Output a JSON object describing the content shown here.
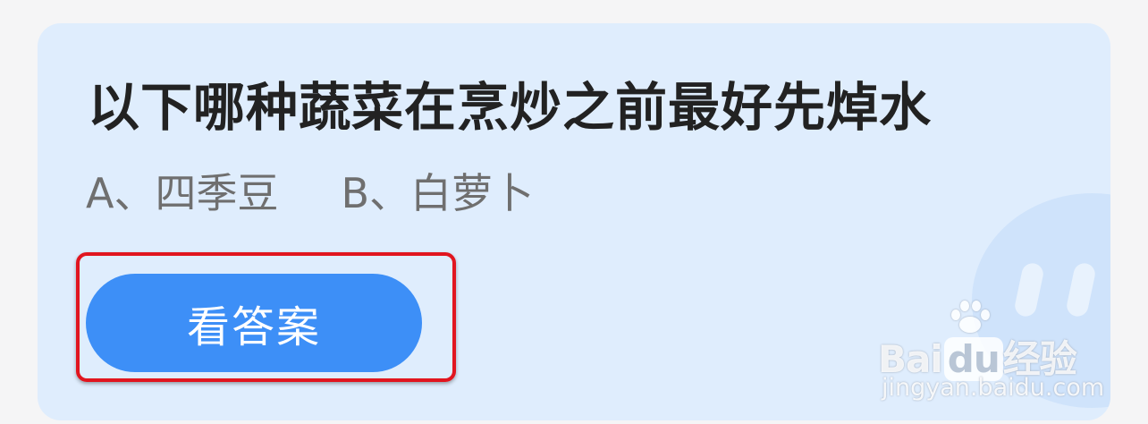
{
  "card": {
    "question": "以下哪种蔬菜在烹炒之前最好先焯水",
    "options": [
      {
        "text": "A、四季豆"
      },
      {
        "text": "B、白萝卜"
      }
    ],
    "answer_button_label": "看答案",
    "colors": {
      "card_background": "#dfedfd",
      "button": "#3d8ff7",
      "highlight_border": "#e1151f"
    }
  },
  "watermark": {
    "logo_text_bai": "Bai",
    "logo_text_du": "du",
    "logo_text_suffix": "经验",
    "url": "jingyan.baidu.com"
  }
}
